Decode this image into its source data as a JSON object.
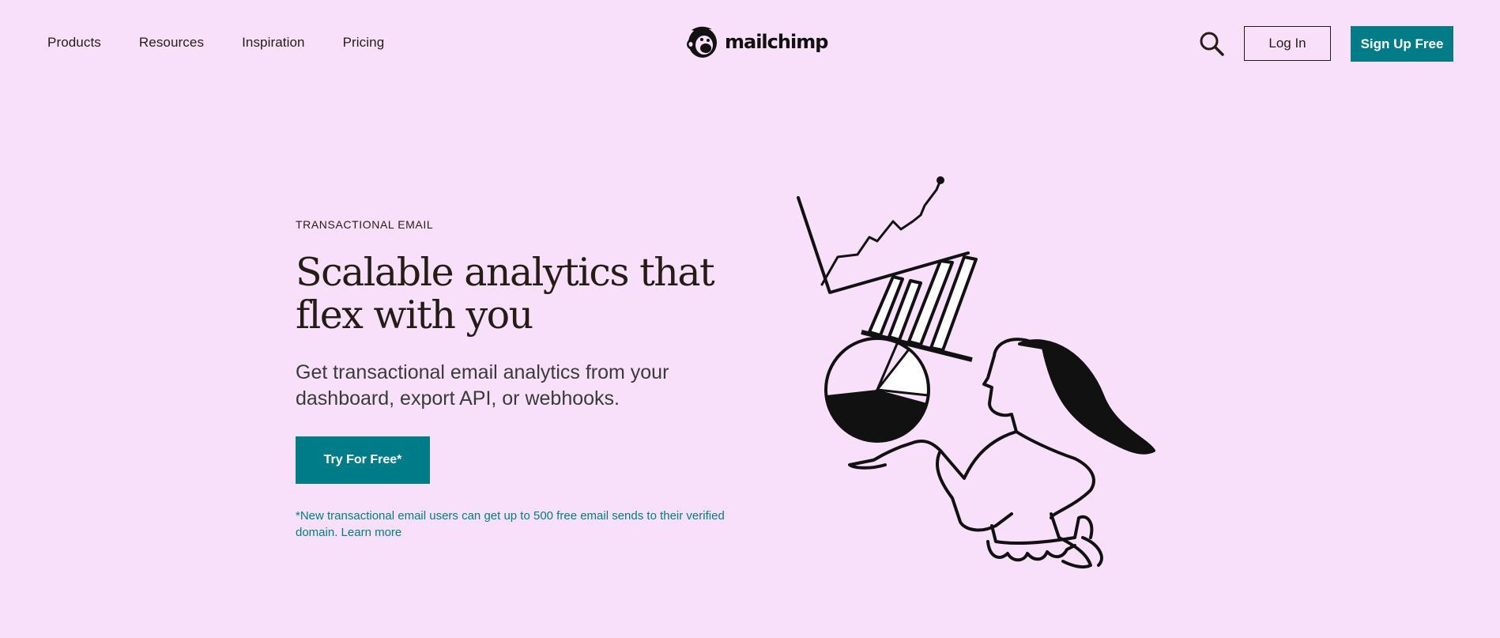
{
  "nav": {
    "links": [
      "Products",
      "Resources",
      "Inspiration",
      "Pricing"
    ],
    "logo_text": "mailchimp",
    "search_icon": "search-icon",
    "login_label": "Log In",
    "signup_label": "Sign Up Free"
  },
  "hero": {
    "eyebrow": "TRANSACTIONAL EMAIL",
    "headline": "Scalable analytics that flex with you",
    "subhead": "Get transactional email analytics from your dashboard, export API, or webhooks.",
    "cta_label": "Try For Free*",
    "footnote": "*New transactional email users can get up to 500 free email sends to their verified domain.",
    "footnote_link": "Learn more"
  },
  "colors": {
    "background": "#f9e0fa",
    "accent": "#007c89",
    "text": "#241c15"
  }
}
